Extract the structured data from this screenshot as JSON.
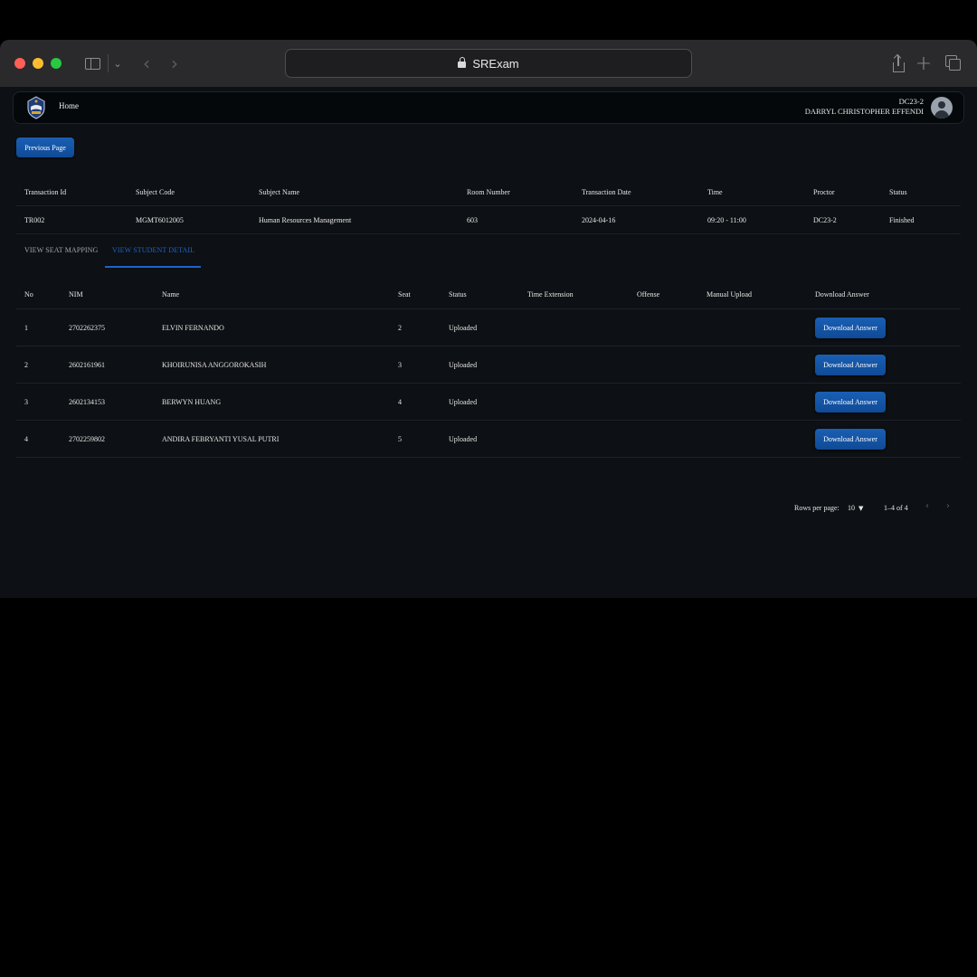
{
  "browser": {
    "address": "SRExam",
    "icons": [
      "sidebar-icon",
      "chevron-down-icon",
      "back-icon",
      "forward-icon",
      "lock-icon",
      "share-icon",
      "plus-icon",
      "tabs-icon"
    ]
  },
  "appbar": {
    "home_label": "Home",
    "user_code": "DC23-2",
    "user_name": "DARRYL CHRISTOPHER EFFENDI"
  },
  "previous_page_label": "Previous Page",
  "transaction": {
    "headers": [
      "Transaction Id",
      "Subject Code",
      "Subject Name",
      "Room Number",
      "Transaction Date",
      "Time",
      "Proctor",
      "Status"
    ],
    "row": [
      "TR002",
      "MGMT6012005",
      "Human Resources Management",
      "603",
      "2024-04-16",
      "09:20 - 11:00",
      "DC23-2",
      "Finished"
    ]
  },
  "tabs": {
    "seat_mapping": "VIEW SEAT MAPPING",
    "student_detail": "VIEW STUDENT DETAIL"
  },
  "students": {
    "headers": [
      "No",
      "NIM",
      "Name",
      "Seat",
      "Status",
      "Time Extension",
      "Offense",
      "Manual Upload",
      "Download Answer"
    ],
    "rows": [
      {
        "no": "1",
        "nim": "2702262375",
        "name": "ELVIN FERNANDO",
        "seat": "2",
        "status": "Uploaded",
        "time_extension": "",
        "offense": "",
        "manual_upload": "",
        "download_label": "Download Answer"
      },
      {
        "no": "2",
        "nim": "2602161961",
        "name": "KHOIRUNISA ANGGOROKASIH",
        "seat": "3",
        "status": "Uploaded",
        "time_extension": "",
        "offense": "",
        "manual_upload": "",
        "download_label": "Download Answer"
      },
      {
        "no": "3",
        "nim": "2602134153",
        "name": "BERWYN HUANG",
        "seat": "4",
        "status": "Uploaded",
        "time_extension": "",
        "offense": "",
        "manual_upload": "",
        "download_label": "Download Answer"
      },
      {
        "no": "4",
        "nim": "2702259802",
        "name": "ANDIRA FEBRYANTI YUSAL PUTRI",
        "seat": "5",
        "status": "Uploaded",
        "time_extension": "",
        "offense": "",
        "manual_upload": "",
        "download_label": "Download Answer"
      }
    ]
  },
  "pagination": {
    "rows_per_page_label": "Rows per page:",
    "rows_per_page_value": "10",
    "range": "1–4 of 4"
  },
  "colors": {
    "accent": "#1e63c8",
    "button": "#1a5fb4",
    "background": "#0d1014"
  }
}
